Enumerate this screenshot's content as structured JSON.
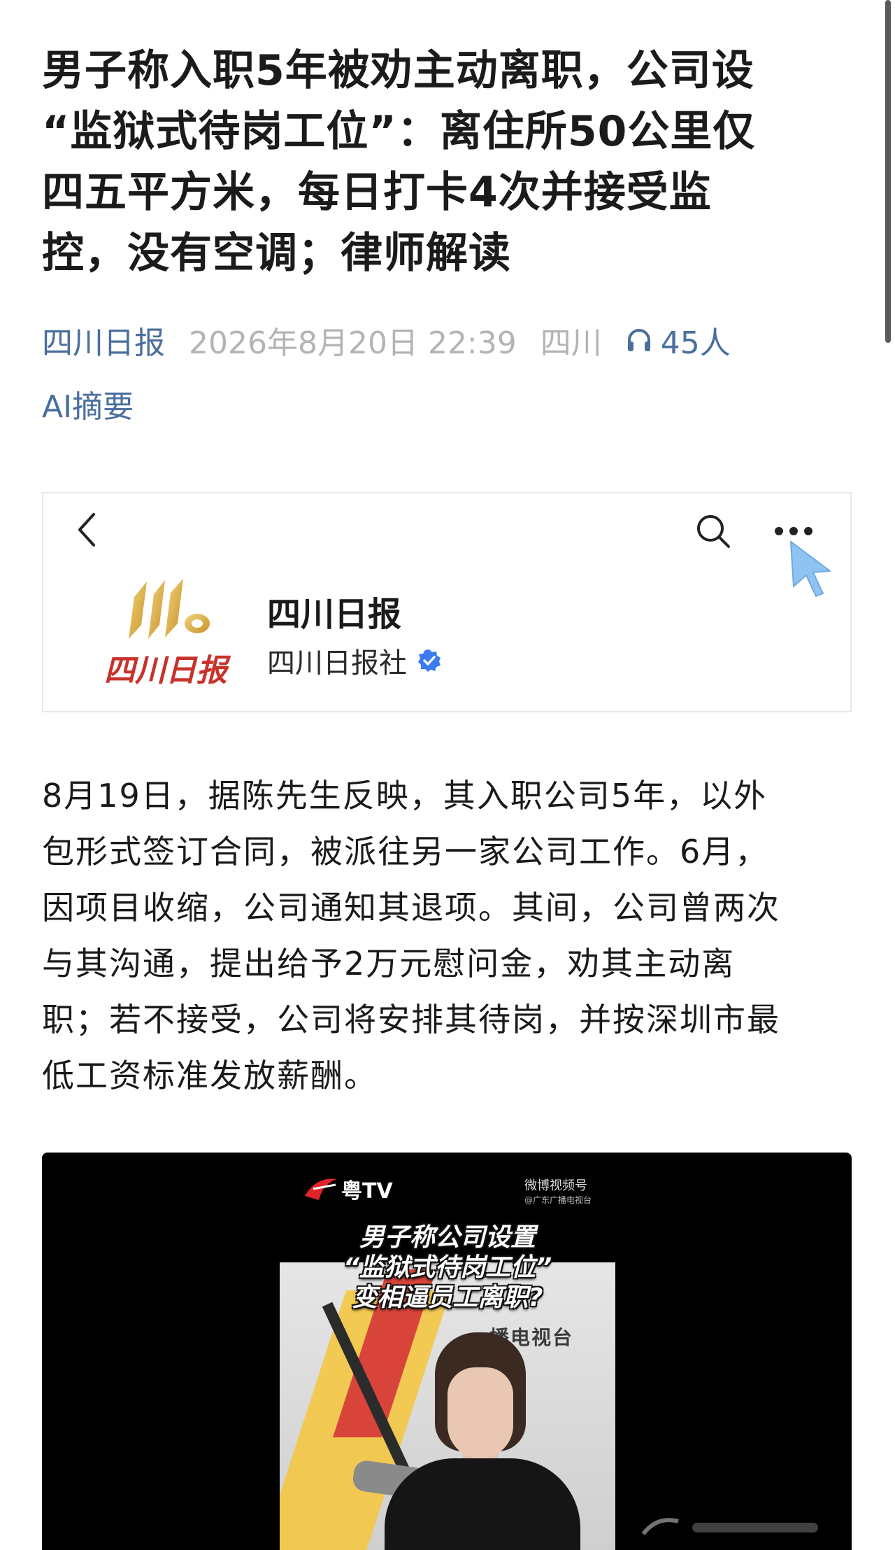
{
  "headline_lines": [
    "男子称入职5年被劝主动离职，公司设",
    "“监狱式待岗工位”：离住所50公里仅",
    "四五平方米，每日打卡4次并接受监",
    "控，没有空调；律师解读"
  ],
  "meta": {
    "source": "四川日报",
    "datetime": "2026年8月20日 22:39",
    "location": "四川",
    "listeners": "45人"
  },
  "ai_summary_label": "AI摘要",
  "embed": {
    "account_name": "四川日报",
    "account_org": "四川日报社",
    "logo_text": "四川日报",
    "icons": [
      "back-chevron-icon",
      "search-icon",
      "more-icon",
      "pointer-cursor-icon",
      "verified-badge-icon"
    ]
  },
  "body_lines": [
    "8月19日，据陈先生反映，其入职公司5年，以外",
    "包形式签订合同，被派往另一家公司工作。6月，",
    "因项目收缩，公司通知其退项。其间，公司曾两次",
    "与其沟通，提出给予2万元慰问金，劝其主动离",
    "职；若不接受，公司将安排其待岗，并按深圳市最",
    "低工资标准发放薪酬。"
  ],
  "video": {
    "brand": "粤TV",
    "platform": "微博视频号",
    "platform_sub": "@广东广播电视台",
    "studio_text": "播电视台",
    "caption_lines": [
      "男子称公司设置",
      "“监狱式待岗工位”",
      "变相逼员工离职?"
    ]
  },
  "colors": {
    "link_blue": "#4a6e9e",
    "meta_gray": "#b4b4b4",
    "verified_blue": "#3b7cf0",
    "cursor_blue": "#8fc3f2"
  }
}
